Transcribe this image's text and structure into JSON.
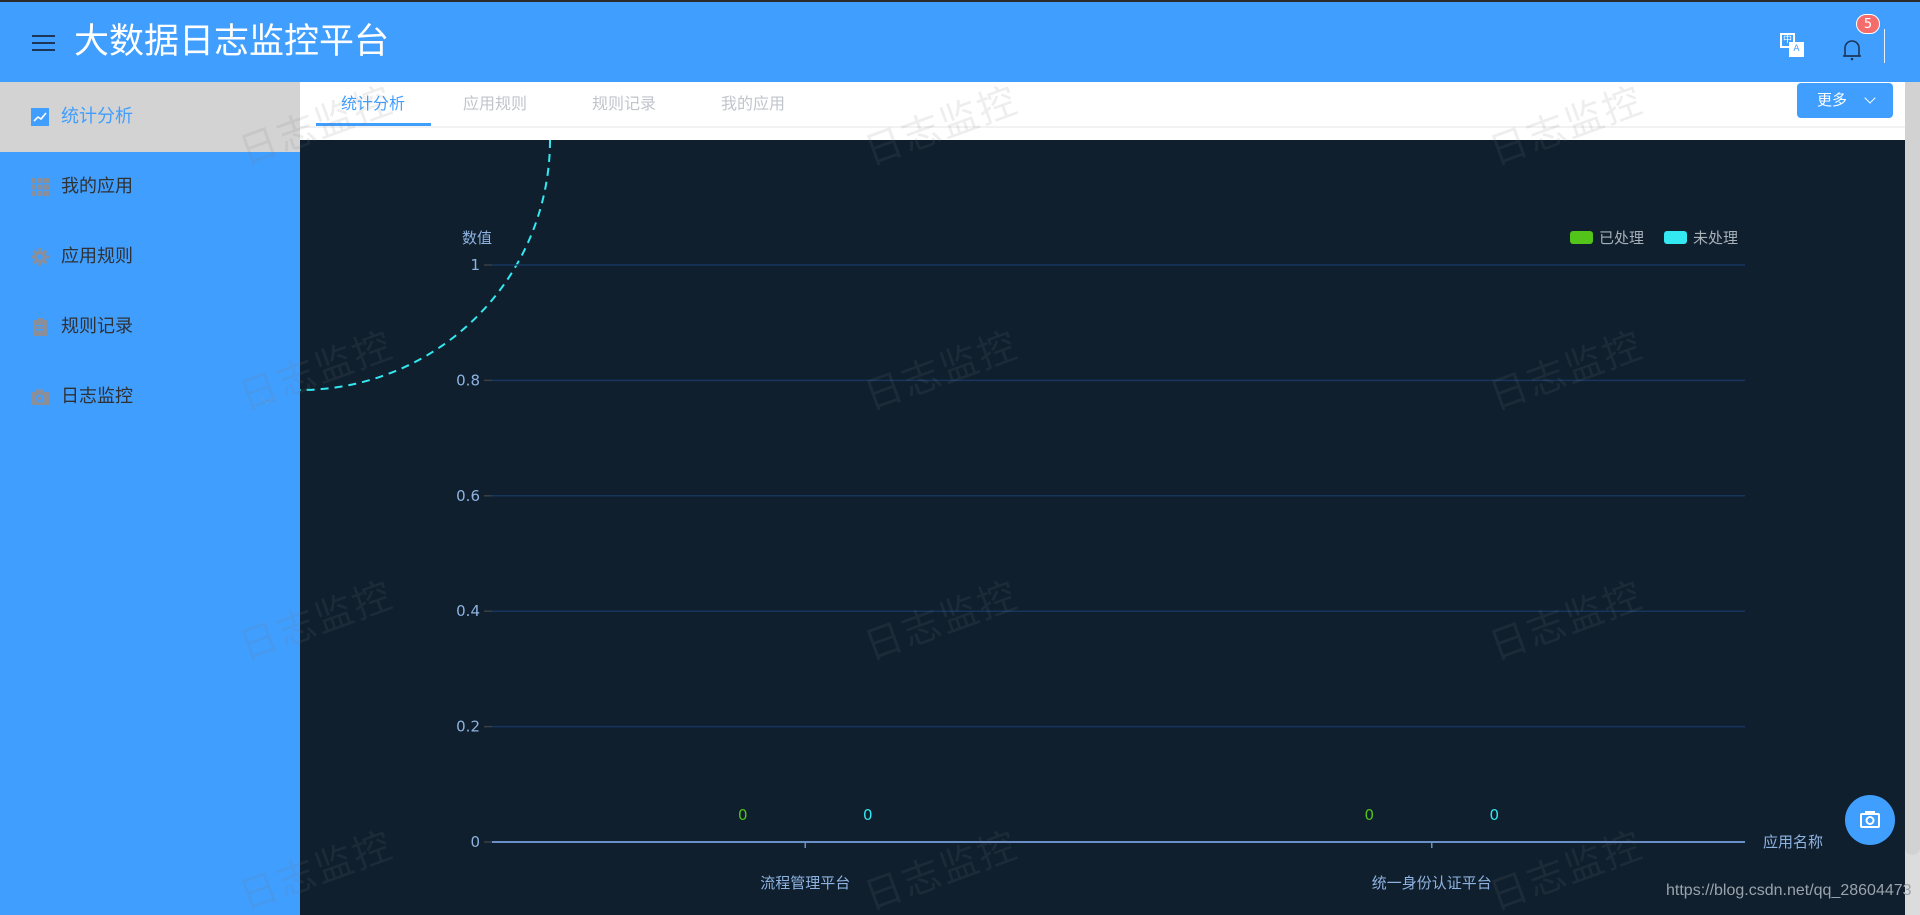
{
  "header": {
    "title": "大数据日志监控平台",
    "translate_zh": "中",
    "translate_en": "A",
    "notification_count": "5"
  },
  "sidebar": {
    "items": [
      {
        "label": "统计分析",
        "icon": "trend-chart-icon",
        "active": true
      },
      {
        "label": "我的应用",
        "icon": "grid-icon",
        "active": false
      },
      {
        "label": "应用规则",
        "icon": "gear-icon",
        "active": false
      },
      {
        "label": "规则记录",
        "icon": "clipboard-icon",
        "active": false
      },
      {
        "label": "日志监控",
        "icon": "camera-icon",
        "active": false
      }
    ]
  },
  "tabs": {
    "items": [
      {
        "label": "统计分析",
        "active": true
      },
      {
        "label": "应用规则",
        "active": false
      },
      {
        "label": "规则记录",
        "active": false
      },
      {
        "label": "我的应用",
        "active": false
      }
    ],
    "more_label": "更多"
  },
  "watermark_text": "日志监控",
  "footer_url": "https://blog.csdn.net/qq_28604473",
  "colors": {
    "primary": "#409eff",
    "chart_bg": "#0f1f2e",
    "processed": "#52c41a",
    "unprocessed": "#33e8f0",
    "badge": "#f56c6c"
  },
  "chart_data": {
    "type": "bar",
    "title": "",
    "xlabel": "应用名称",
    "ylabel": "数值",
    "categories": [
      "流程管理平台",
      "统一身份认证平台"
    ],
    "series": [
      {
        "name": "已处理",
        "values": [
          0,
          0
        ],
        "color": "#52c41a"
      },
      {
        "name": "未处理",
        "values": [
          0,
          0
        ],
        "color": "#33e8f0"
      }
    ],
    "ylim": [
      0,
      1
    ],
    "yticks": [
      "0",
      "0.2",
      "0.4",
      "0.6",
      "0.8",
      "1"
    ],
    "grid": true,
    "legend": "top-right",
    "data_labels": true
  }
}
